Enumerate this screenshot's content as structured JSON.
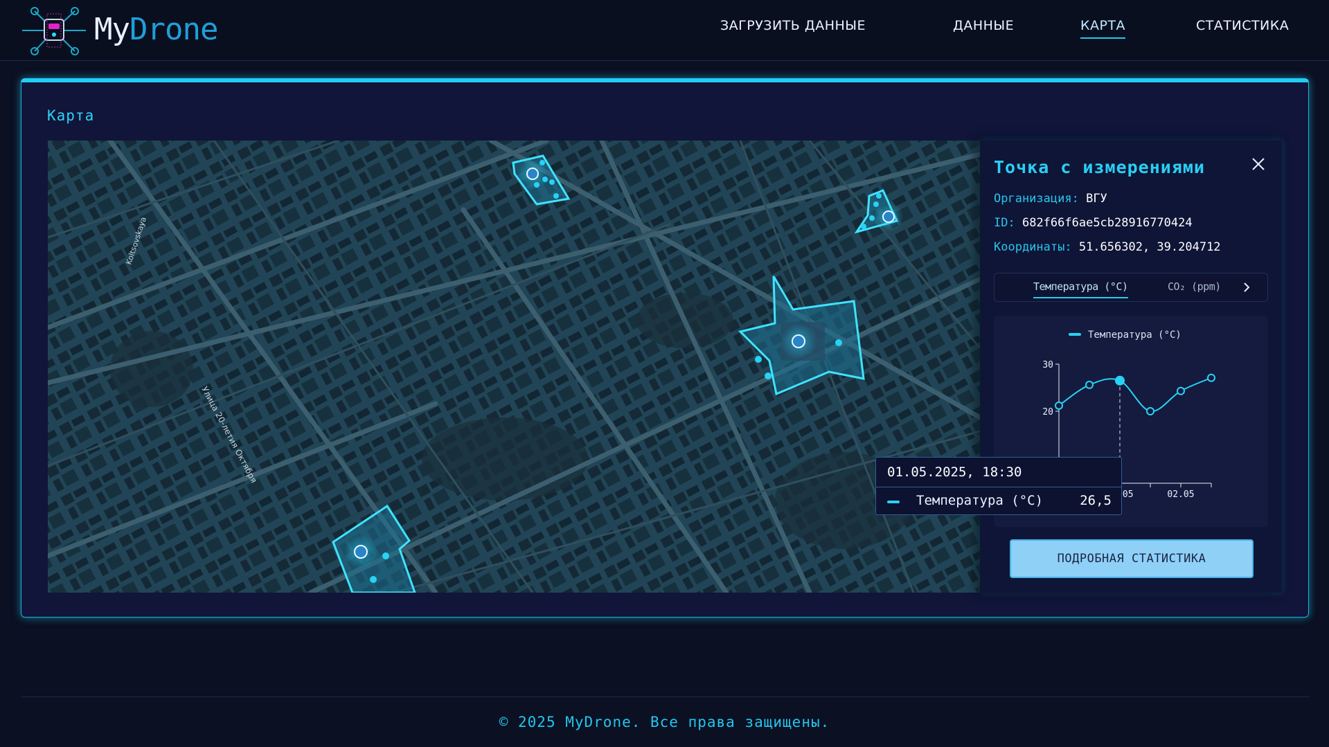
{
  "header": {
    "brand_my": "My",
    "brand_drone": "Drone",
    "nav": [
      {
        "label": "ЗАГРУЗИТЬ ДАННЫЕ",
        "active": false
      },
      {
        "label": "ДАННЫЕ",
        "active": false
      },
      {
        "label": "КАРТА",
        "active": true
      },
      {
        "label": "СТАТИСТИКА",
        "active": false
      }
    ]
  },
  "main": {
    "title": "Карта",
    "map": {
      "street_labels": [
        "Koltsovskaya",
        "Улица 20-летия Октября"
      ]
    }
  },
  "panel": {
    "title": "Точка с измерениями",
    "organization_label": "Организация:",
    "organization_value": "ВГУ",
    "id_label": "ID:",
    "id_value": "682f66f6ae5cb28916770424",
    "coords_label": "Координаты:",
    "coords_value": "51.656302, 39.204712",
    "tabs": [
      {
        "label": "Температура (°C)",
        "active": true
      },
      {
        "label": "CO₂ (ppm)",
        "active": false
      }
    ],
    "details_button": "ПОДРОБНАЯ СТАТИСТИКА"
  },
  "tooltip": {
    "datetime": "01.05.2025, 18:30",
    "series": "Температура (°C)",
    "value": "26,5"
  },
  "chart_data": {
    "type": "line",
    "legend": "Температура (°C)",
    "yticks": [
      "20",
      "30"
    ],
    "xticks": [
      "01.05",
      "02.05"
    ],
    "ylim": [
      10,
      30
    ],
    "x": [
      0,
      1,
      2,
      3,
      4,
      5
    ],
    "series": [
      {
        "name": "Температура (°C)",
        "values": [
          21.2,
          25.6,
          26.5,
          20.0,
          24.3,
          27.1
        ]
      }
    ],
    "highlight_index": 2,
    "color": "#27d3f5"
  },
  "footer": {
    "text": "© 2025 MyDrone. Все права защищены."
  },
  "colors": {
    "accent": "#22cdf4",
    "background": "#0b1022",
    "card": "#101539"
  }
}
